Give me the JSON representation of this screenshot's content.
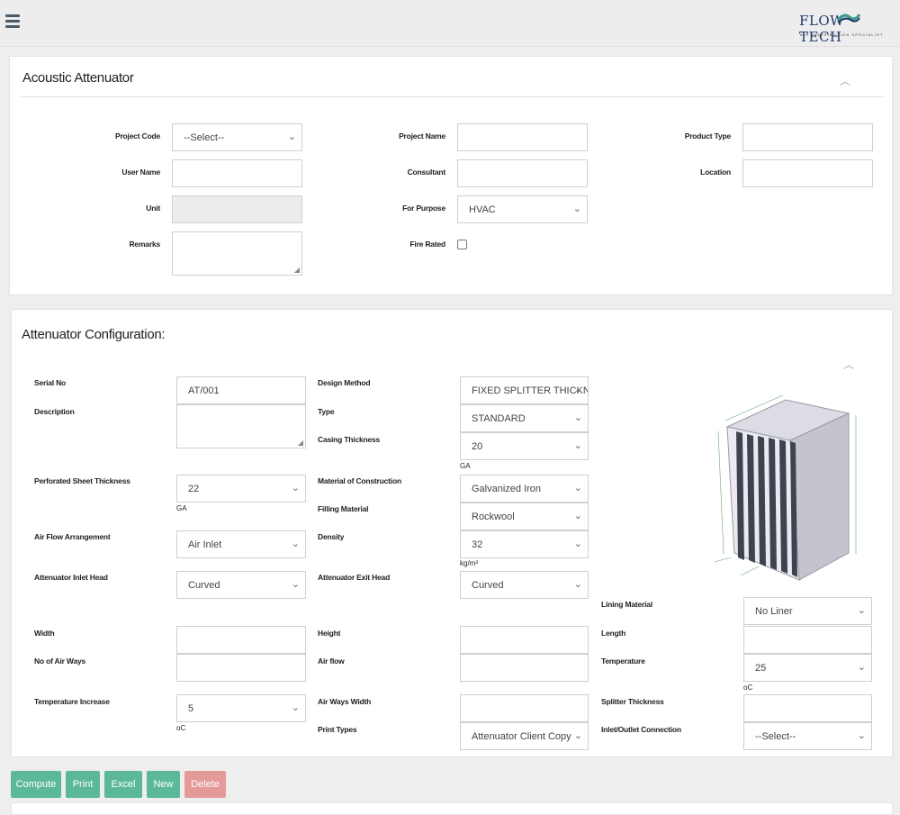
{
  "header": {
    "logo_text": "FLOW TECH",
    "logo_sub": "AIR DISTRIBUTION SPECIALIST"
  },
  "project": {
    "title": "Acoustic Attenuator",
    "labels": {
      "project_code": "Project Code",
      "project_name": "Project Name",
      "product_type": "Product Type",
      "user_name": "User Name",
      "consultant": "Consultant",
      "location": "Location",
      "unit": "Unit",
      "for_purpose": "For Purpose",
      "remarks": "Remarks",
      "fire_rated": "Fire Rated"
    },
    "values": {
      "project_code": "--Select--",
      "for_purpose": "HVAC"
    }
  },
  "config": {
    "title": "Attenuator Configuration:",
    "labels": {
      "serial_no": "Serial No",
      "description": "Description",
      "design_method": "Design Method",
      "type": "Type",
      "casing_thickness": "Casing Thickness",
      "perforated_sheet_thickness": "Perforated Sheet Thickness",
      "material_of_construction": "Material of Construction",
      "filling_material": "Filling Material",
      "air_flow_arrangement": "Air Flow Arrangement",
      "density": "Density",
      "attenuator_inlet_head": "Attenuator Inlet Head",
      "attenuator_exit_head": "Attenuator Exit Head",
      "lining_material": "Lining Material",
      "width": "Width",
      "height": "Height",
      "length": "Length",
      "no_of_air_ways": "No of Air Ways",
      "air_flow": "Air flow",
      "temperature": "Temperature",
      "temperature_increase": "Temperature Increase",
      "air_ways_width": "Air Ways Width",
      "splitter_thickness": "Splitter Thickness",
      "print_types": "Print Types",
      "inlet_outlet_connection": "Inlet/Outlet Connection"
    },
    "values": {
      "serial_no": "AT/001",
      "design_method": "FIXED SPLITTER THICKNESS",
      "type": "STANDARD",
      "casing_thickness": "20",
      "perforated_sheet_thickness": "22",
      "material_of_construction": "Galvanized Iron",
      "filling_material": "Rockwool",
      "air_flow_arrangement": "Air Inlet",
      "density": "32",
      "attenuator_inlet_head": "Curved",
      "attenuator_exit_head": "Curved",
      "lining_material": "No Liner",
      "temperature": "25",
      "temperature_increase": "5",
      "print_types": "Attenuator Client Copy",
      "inlet_outlet_connection": "--Select--"
    },
    "units": {
      "ga1": "GA",
      "ga2": "GA",
      "density": "kg/m³",
      "oc1": "oC",
      "oc2": "oC"
    }
  },
  "buttons": {
    "compute": "Compute",
    "print": "Print",
    "excel": "Excel",
    "new": "New",
    "delete": "Delete"
  },
  "colors": {
    "accent_green": "#5cb89a",
    "delete_red": "#e59a9a",
    "logo_blue": "#1f3a6b"
  }
}
